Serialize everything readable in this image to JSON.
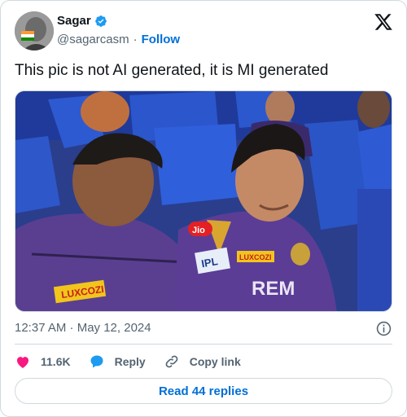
{
  "author": {
    "name": "Sagar",
    "handle": "@sagarcasm",
    "separator": "·",
    "follow_label": "Follow",
    "verified_color": "#1d9bf0"
  },
  "tweet": {
    "text": "This pic is not AI generated, it is MI generated",
    "timestamp": "12:37 AM · May 12, 2024"
  },
  "media": {
    "jersey_texts": [
      "LUXCOZI",
      "Jio",
      "IPL",
      "LUXCOZI",
      "REM"
    ]
  },
  "actions": {
    "likes_count": "11.6K",
    "reply_label": "Reply",
    "copy_link_label": "Copy link",
    "like_color": "#f91880",
    "reply_color": "#1d9bf0"
  },
  "read_replies_label": "Read 44 replies",
  "icons": [
    "verified-badge-icon",
    "x-logo-icon",
    "info-icon",
    "heart-icon",
    "reply-bubble-icon",
    "link-icon"
  ]
}
